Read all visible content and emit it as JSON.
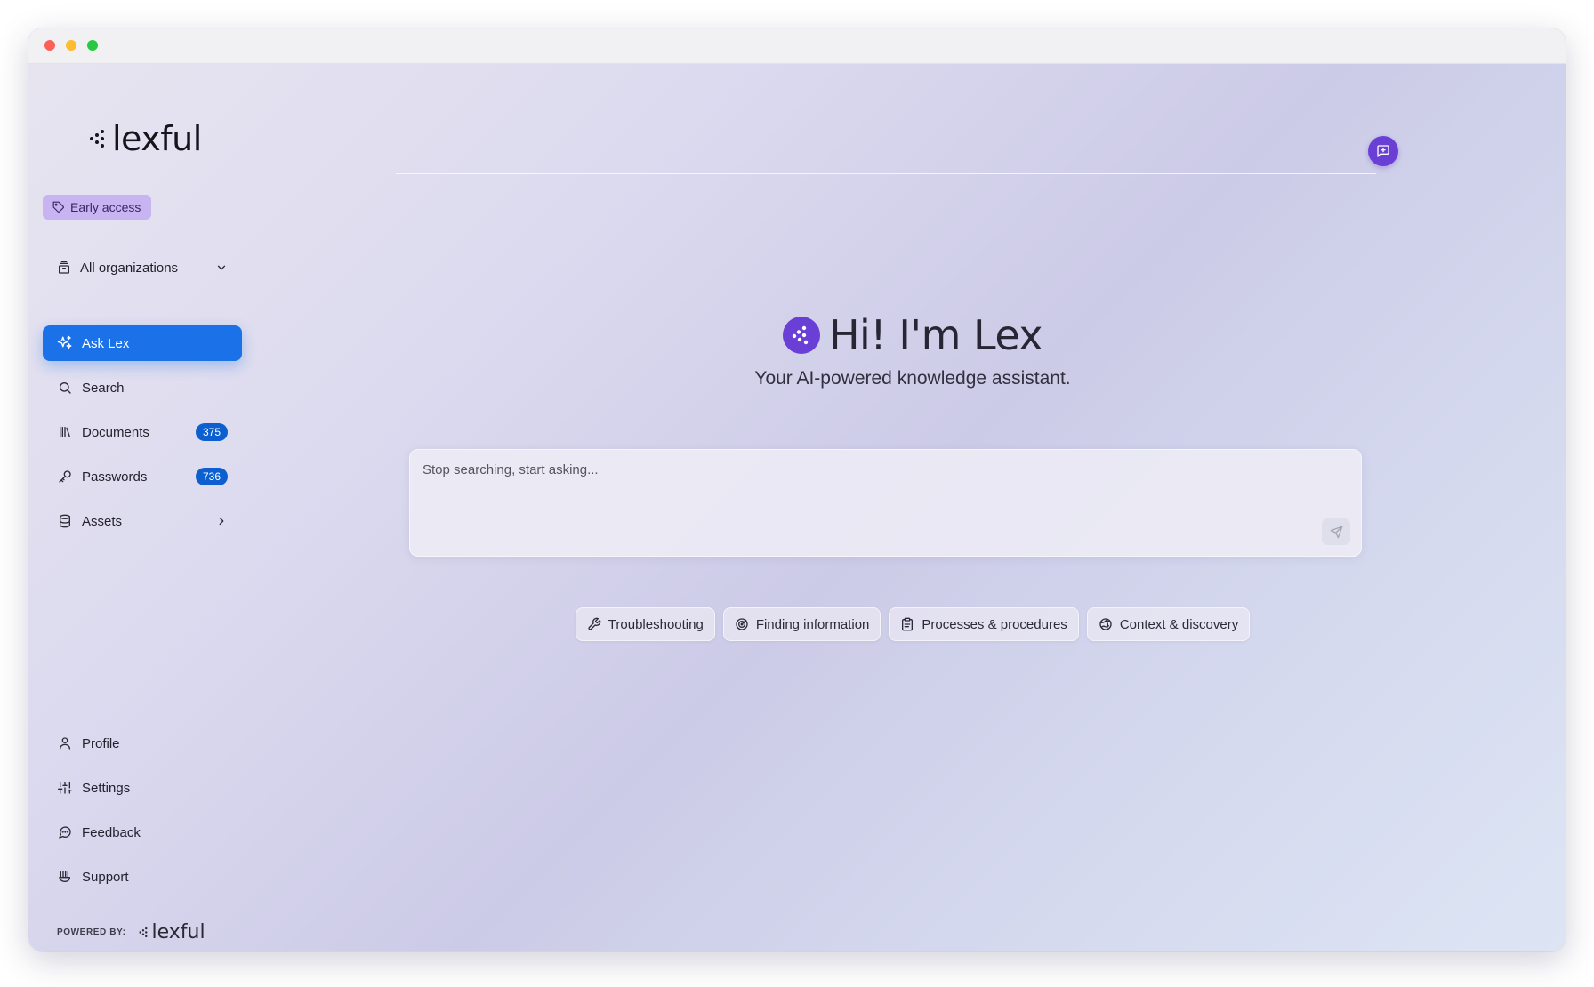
{
  "app": {
    "logo_text": "lexful",
    "badge": "Early access"
  },
  "org_selector": {
    "value": "All organizations"
  },
  "nav": {
    "items": [
      {
        "label": "Ask Lex",
        "icon": "sparkles-icon",
        "active": true
      },
      {
        "label": "Search",
        "icon": "search-icon"
      },
      {
        "label": "Documents",
        "icon": "library-icon",
        "count": "375"
      },
      {
        "label": "Passwords",
        "icon": "key-icon",
        "count": "736"
      },
      {
        "label": "Assets",
        "icon": "database-icon"
      }
    ]
  },
  "nav_bottom": {
    "items": [
      {
        "label": "Profile",
        "icon": "user-icon"
      },
      {
        "label": "Settings",
        "icon": "sliders-icon"
      },
      {
        "label": "Feedback",
        "icon": "message-circle-icon"
      },
      {
        "label": "Support",
        "icon": "support-icon"
      }
    ]
  },
  "footer": {
    "powered_by": "POWERED BY:",
    "logo_text": "lexful"
  },
  "hero": {
    "title": "Hi! I'm Lex",
    "subtitle": "Your AI-powered knowledge assistant."
  },
  "prompt": {
    "placeholder": "Stop searching, start asking..."
  },
  "suggestions": [
    {
      "label": "Troubleshooting",
      "icon": "wrench-icon"
    },
    {
      "label": "Finding information",
      "icon": "radar-icon"
    },
    {
      "label": "Processes & procedures",
      "icon": "clipboard-icon"
    },
    {
      "label": "Context & discovery",
      "icon": "globe-icon"
    }
  ],
  "colors": {
    "accent_blue": "#1b72e8",
    "brand_purple": "#6a3fd6",
    "badge_purple": "#c8b4f0"
  }
}
